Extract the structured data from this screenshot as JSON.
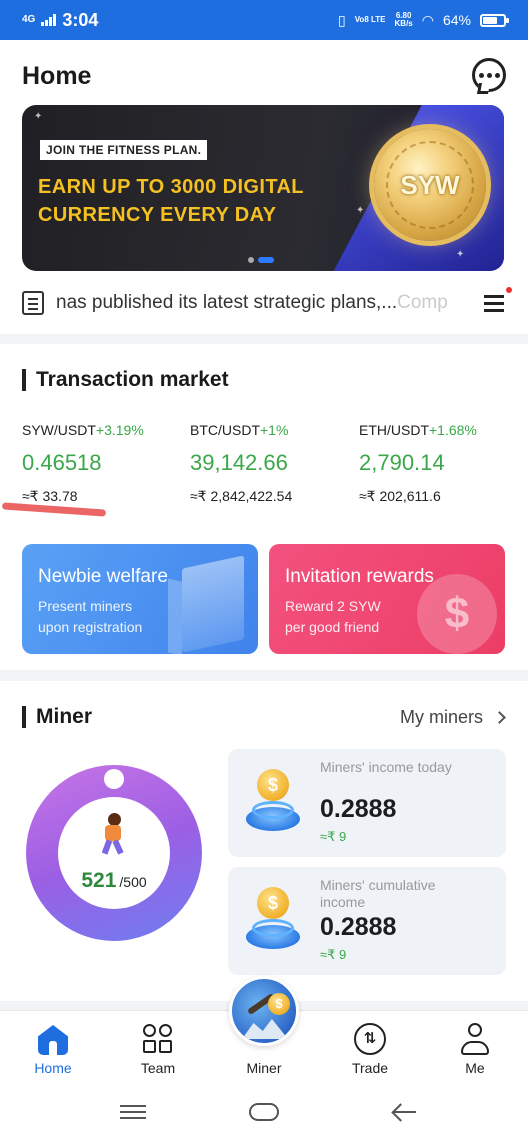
{
  "status_bar": {
    "network": "4G",
    "time": "3:04",
    "volte": "Vo8 LTE",
    "speed_value": "6.80",
    "speed_unit": "KB/s",
    "battery": "64%",
    "battery_level": 0.64
  },
  "header": {
    "title": "Home",
    "chat_icon": "chat-bubble-icon"
  },
  "banner": {
    "tag": "JOIN THE FITNESS PLAN.",
    "headline_line1": "EARN UP TO 3000 DIGITAL",
    "headline_line2": "CURRENCY EVERY DAY",
    "coin_text": "SYW",
    "active_slide": 2,
    "slide_count": 2
  },
  "news": {
    "icon": "document-icon",
    "text": "nas published its latest strategic plans,...",
    "fade_text": "Comp",
    "menu_icon": "menu-icon"
  },
  "market": {
    "title": "Transaction market",
    "tickers": [
      {
        "pair": "SYW/USDT",
        "change": "+3.19%",
        "price": "0.46518",
        "approx": "≈₹ 33.78"
      },
      {
        "pair": "BTC/USDT",
        "change": "+1%",
        "price": "39,142.66",
        "approx": "≈₹ 2,842,422.54"
      },
      {
        "pair": "ETH/USDT",
        "change": "+1.68%",
        "price": "2,790.14",
        "approx": "≈₹ 202,611.6"
      }
    ],
    "promos": [
      {
        "title": "Newbie welfare",
        "line1": "Present miners",
        "line2": "upon registration",
        "color": "#4a8ef0"
      },
      {
        "title": "Invitation rewards",
        "line1": "Reward 2 SYW",
        "line2": "per good friend",
        "color": "#ef4570"
      }
    ]
  },
  "miner": {
    "title": "Miner",
    "my_miners": "My miners",
    "count": "521",
    "total": "/500",
    "income_today_label": "Miners' income today",
    "income_today_value": "0.2888",
    "income_today_sub": "≈₹ 9",
    "cumulative_label": "Miners' cumulative income",
    "cumulative_value": "0.2888",
    "cumulative_sub": "≈₹ 9"
  },
  "bottom_nav": {
    "items": [
      {
        "label": "Home",
        "icon": "home-icon",
        "active": true
      },
      {
        "label": "Team",
        "icon": "team-icon",
        "active": false
      },
      {
        "label": "Miner",
        "icon": "miner-icon",
        "active": false
      },
      {
        "label": "Trade",
        "icon": "trade-icon",
        "active": false
      },
      {
        "label": "Me",
        "icon": "user-icon",
        "active": false
      }
    ]
  },
  "colors": {
    "brand": "#1f6ee0",
    "positive": "#3aa84a",
    "promo_blue": "#4a8ef0",
    "promo_red": "#ef4570",
    "banner_gold": "#f5c021"
  }
}
